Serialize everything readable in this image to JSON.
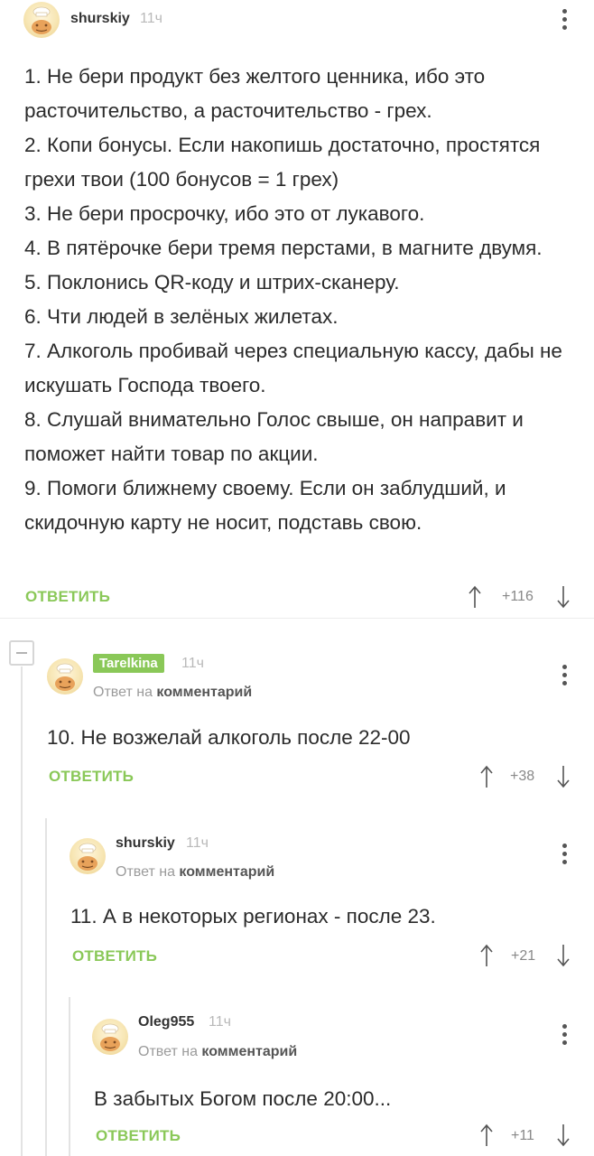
{
  "comments": [
    {
      "username": "shurskiy",
      "time": "11ч",
      "lines": [
        "1. Не бери продукт без желтого ценника, ибо это расточительство, а расточительство - грех.",
        "2. Копи бонусы. Если накопишь достаточно, простятся грехи твои (100 бонусов = 1 грех)",
        "3. Не бери просрочку, ибо это от лукавого.",
        "4. В пятёрочке бери тремя перстами, в магните двумя.",
        "5. Поклонись QR-коду и штрих-сканеру.",
        "6. Чти людей в зелёных жилетах.",
        "7. Алкоголь пробивай через специальную кассу, дабы не искушать Господа твоего.",
        "8. Слушай внимательно Голос свыше, он направит и поможет найти товар по акции.",
        "9. Помоги ближнему своему. Если он заблудший, и скидочную карту не носит, подставь свою."
      ],
      "reply_label": "ОТВЕТИТЬ",
      "rating": "+116"
    },
    {
      "username": "Tarelkina",
      "time": "11ч",
      "meta_prefix": "Ответ на",
      "meta_link": "комментарий",
      "text": "10. Не возжелай алкоголь после 22-00",
      "reply_label": "ОТВЕТИТЬ",
      "rating": "+38"
    },
    {
      "username": "shurskiy",
      "time": "11ч",
      "meta_prefix": "Ответ на",
      "meta_link": "комментарий",
      "text": "11. А в некоторых регионах - после 23.",
      "reply_label": "ОТВЕТИТЬ",
      "rating": "+21"
    },
    {
      "username": "Oleg955",
      "time": "11ч",
      "meta_prefix": "Ответ на",
      "meta_link": "комментарий",
      "text": "В забытых Богом после 20:00...",
      "reply_label": "ОТВЕТИТЬ",
      "rating": "+11"
    }
  ],
  "icons": {
    "avatar": "default-chef-avatar-icon",
    "menu": "kebab-menu-icon",
    "upvote": "arrow-up-icon",
    "downvote": "arrow-down-icon",
    "collapse": "collapse-minus-icon"
  },
  "colors": {
    "accent": "#8ac858",
    "muted": "#b9b9b9",
    "text": "#2b2b2b"
  }
}
